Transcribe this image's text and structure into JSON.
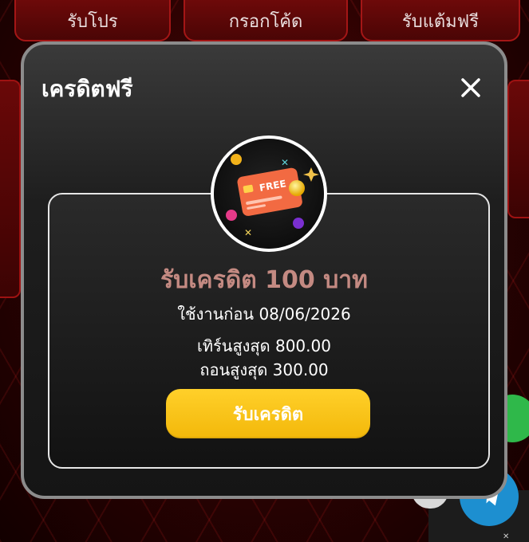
{
  "background": {
    "tabs": [
      {
        "label": "รับโปร"
      },
      {
        "label": "กรอกโค้ด"
      },
      {
        "label": "รับแต้มฟรี"
      }
    ]
  },
  "modal": {
    "title": "เครดิตฟรี",
    "close_icon": "close-icon",
    "badge": {
      "icon": "free-credit-card-icon",
      "card_text": "FREE"
    },
    "heading": "รับเครดิต 100 บาท",
    "use_before": "ใช้งานก่อน 08/06/2026",
    "max_turnover": "เทิร์นสูงสุด 800.00",
    "max_withdraw": "ถอนสูงสุด 300.00",
    "claim_button": "รับเครดิต"
  },
  "colors": {
    "accent_button": "#f5c014",
    "heading": "#c48a82",
    "background_red": "#5a0606"
  }
}
